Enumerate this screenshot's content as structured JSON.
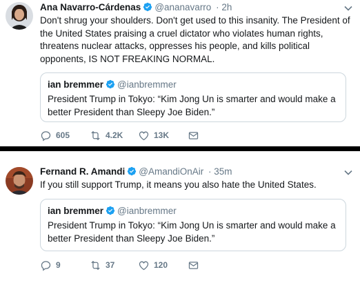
{
  "tweets": [
    {
      "name": "Ana Navarro-Cárdenas",
      "handle": "@ananavarro",
      "time": "· 2h",
      "text": "Don't shrug your shoulders. Don't get used to this insanity. The President of the United States praising a cruel dictator who violates human rights, threatens nuclear attacks, oppresses his people, and kills political opponents, IS NOT FREAKING NORMAL.",
      "quote": {
        "name": "ian bremmer",
        "handle": "@ianbremmer",
        "text": "President Trump in Tokyo: “Kim Jong Un is smarter and would make a better President than Sleepy Joe Biden.”"
      },
      "stats": {
        "replies": "605",
        "retweets": "4.2K",
        "likes": "13K"
      }
    },
    {
      "name": "Fernand R. Amandi",
      "handle": "@AmandiOnAir",
      "time": "· 35m",
      "text": "If you still support Trump, it means you also hate the United States.",
      "quote": {
        "name": "ian bremmer",
        "handle": "@ianbremmer",
        "text": "President Trump in Tokyo: “Kim Jong Un is smarter and would make a better President than Sleepy Joe Biden.”"
      },
      "stats": {
        "replies": "9",
        "retweets": "37",
        "likes": "120"
      }
    }
  ],
  "colors": {
    "text": "#14171a",
    "secondary": "#657786",
    "verified": "#1da1f2",
    "border": "#ccd6dd"
  },
  "icons": [
    "verified-badge-icon",
    "chevron-down-icon",
    "reply-icon",
    "retweet-icon",
    "like-icon",
    "message-icon"
  ]
}
